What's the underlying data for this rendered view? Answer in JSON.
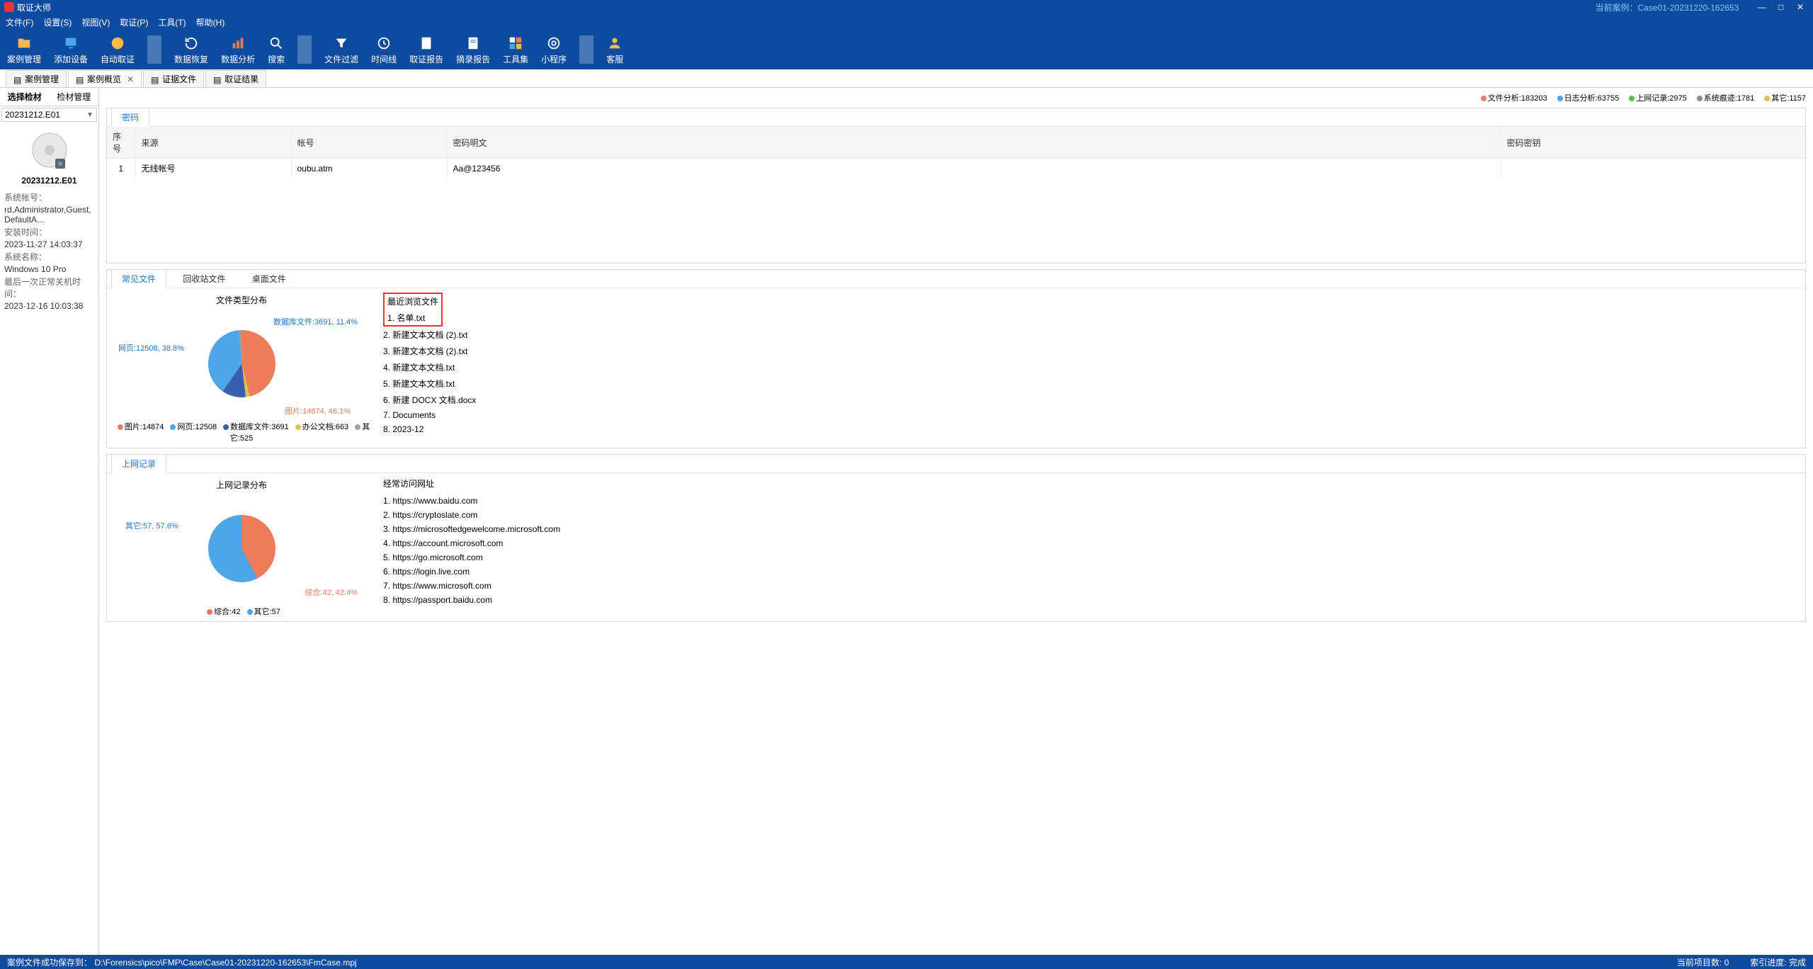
{
  "app_title": "取证大师",
  "current_case_label": "当前案例：",
  "current_case": "Case01-20231220-162653",
  "menus": [
    "文件(F)",
    "设置(S)",
    "视图(V)",
    "取证(P)",
    "工具(T)",
    "帮助(H)"
  ],
  "toolbar": [
    "案例管理",
    "添加设备",
    "自动取证",
    "数据恢复",
    "数据分析",
    "搜索",
    "文件过滤",
    "时间线",
    "取证报告",
    "摘录报告",
    "工具集",
    "小程序",
    "客服"
  ],
  "tabs": [
    {
      "label": "案例管理",
      "active": false,
      "closable": false
    },
    {
      "label": "案例概览",
      "active": true,
      "closable": true
    },
    {
      "label": "证据文件",
      "active": false,
      "closable": false
    },
    {
      "label": "取证结果",
      "active": false,
      "closable": false
    }
  ],
  "sidebar": {
    "tab1": "选择检材",
    "tab2": "检材管理",
    "select_value": "20231212.E01",
    "disk_name": "20231212.E01",
    "info": {
      "sys_account_label": "系统帐号：",
      "sys_account": "rd,Administrator,Guest,DefaultA...",
      "install_label": "安装时间：",
      "install": "2023-11-27 14:03:37",
      "sysname_label": "系统名称：",
      "sysname": "Windows 10 Pro",
      "last_shutdown_label": "最后一次正常关机时间：",
      "last_shutdown": "2023-12-16 10:03:38"
    }
  },
  "stats": [
    {
      "color": "#e98060",
      "label": "文件分析:183203"
    },
    {
      "color": "#4da6e8",
      "label": "日志分析:63755"
    },
    {
      "color": "#5bb85b",
      "label": "上网记录:2975"
    },
    {
      "color": "#8c8c8c",
      "label": "系统痕迹:1781"
    },
    {
      "color": "#e0c24a",
      "label": "其它:1157"
    }
  ],
  "password_panel": {
    "title": "密码",
    "columns": [
      "序号",
      "来源",
      "帐号",
      "密码明文",
      "密码密钥"
    ],
    "rows": [
      {
        "idx": "1",
        "source": "无线帐号",
        "account": "oubu.atm",
        "plain": "Aa@123456",
        "key": ""
      }
    ]
  },
  "file_tabs": [
    "常见文件",
    "回收站文件",
    "桌面文件"
  ],
  "chart_data": [
    {
      "type": "pie",
      "title": "文件类型分布",
      "series": [
        {
          "name": "图片",
          "value": 14874,
          "pct": 46.1,
          "color": "#ed7d5a"
        },
        {
          "name": "网页",
          "value": 12508,
          "pct": 38.8,
          "color": "#4da6e8"
        },
        {
          "name": "数据库文件",
          "value": 3691,
          "pct": 11.4,
          "color": "#3a5fae"
        },
        {
          "name": "办公文档",
          "value": 663,
          "pct": 2.1,
          "color": "#e0c24a"
        },
        {
          "name": "其它",
          "value": 525,
          "pct": 1.6,
          "color": "#9e9e9e"
        }
      ],
      "callouts": [
        {
          "text": "数据库文件:3691, 11.4%"
        },
        {
          "text": "网页:12508, 38.8%"
        },
        {
          "text": "图片:14874, 46.1%"
        }
      ],
      "legend_text": "图片:14874  网页:12508  数据库文件:3691  办公文档:663  其它:525"
    },
    {
      "type": "pie",
      "title": "上网记录分布",
      "series": [
        {
          "name": "综合",
          "value": 42,
          "pct": 42.4,
          "color": "#ed7d5a"
        },
        {
          "name": "其它",
          "value": 57,
          "pct": 57.6,
          "color": "#4da6e8"
        }
      ],
      "callouts": [
        {
          "text": "其它:57, 57.6%"
        },
        {
          "text": "综合:42, 42.4%"
        }
      ],
      "legend_text": "综合:42  其它:57"
    }
  ],
  "recent_files": {
    "title": "最近浏览文件",
    "items": [
      "名单.txt",
      "新建文本文档 (2).txt",
      "新建文本文档 (2).txt",
      "新建文本文档.txt",
      "新建文本文档.txt",
      "新建 DOCX 文档.docx",
      "Documents",
      "2023-12"
    ]
  },
  "net_tab": "上网记录",
  "frequent_sites": {
    "title": "经常访问网址",
    "items": [
      "https://www.baidu.com",
      "https://cryptoslate.com",
      "https://microsoftedgewelcome.microsoft.com",
      "https://account.microsoft.com",
      "https://go.microsoft.com",
      "https://login.live.com",
      "https://www.microsoft.com",
      "https://passport.baidu.com"
    ]
  },
  "statusbar": {
    "save_msg": "案例文件成功保存到：",
    "save_path": "D:\\Forensics\\pico\\FMP\\Case\\Case01-20231220-162653\\FmCase.mpj",
    "items_label": "当前项目数:",
    "items_count": "0",
    "index_label": "索引进度:",
    "index_value": "完成"
  }
}
